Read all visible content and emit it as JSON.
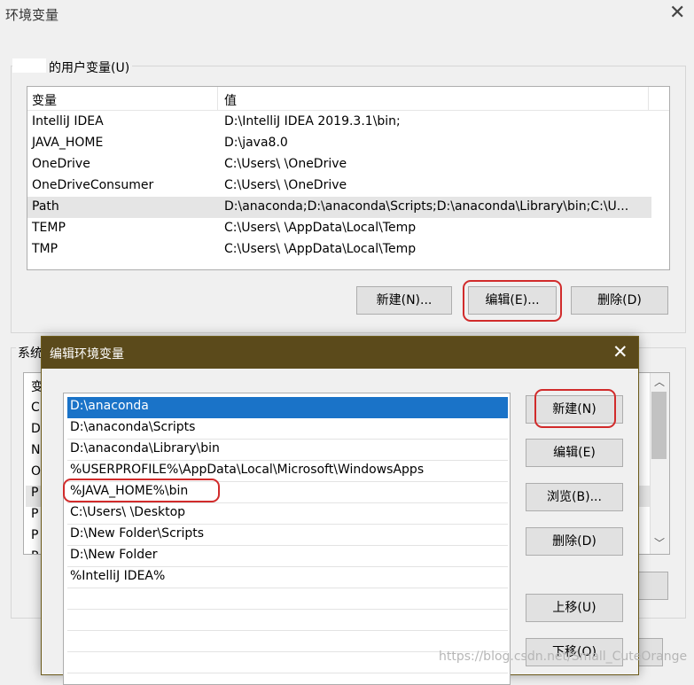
{
  "background_dialog": {
    "title": "环境变量",
    "close_glyph": "✕",
    "user_group_label": "的用户变量(U)",
    "table_headers": {
      "variable": "变量",
      "value": "值"
    },
    "user_variables": [
      {
        "name": "IntelliJ IDEA",
        "value": "D:\\IntelliJ IDEA 2019.3.1\\bin;"
      },
      {
        "name": "JAVA_HOME",
        "value": "D:\\java8.0"
      },
      {
        "name": "OneDrive",
        "value": "C:\\Users\\       \\OneDrive"
      },
      {
        "name": "OneDriveConsumer",
        "value": "C:\\Users\\       \\OneDrive"
      },
      {
        "name": "Path",
        "value": "D:\\anaconda;D:\\anaconda\\Scripts;D:\\anaconda\\Library\\bin;C:\\U..."
      },
      {
        "name": "TEMP",
        "value": "C:\\Users\\       \\AppData\\Local\\Temp"
      },
      {
        "name": "TMP",
        "value": "C:\\Users\\       \\AppData\\Local\\Temp"
      }
    ],
    "user_buttons": {
      "new": "新建(N)...",
      "edit": "编辑(E)...",
      "delete": "删除(D)"
    },
    "system_group_label": "系统",
    "system_visible_cells": [
      "变",
      "C",
      "D",
      "N",
      "O",
      "P",
      "P",
      "P",
      "P"
    ]
  },
  "edit_dialog": {
    "title": "编辑环境变量",
    "close_glyph": "✕",
    "entries": [
      "D:\\anaconda",
      "D:\\anaconda\\Scripts",
      "D:\\anaconda\\Library\\bin",
      "%USERPROFILE%\\AppData\\Local\\Microsoft\\WindowsApps",
      "%JAVA_HOME%\\bin",
      "C:\\Users\\       \\Desktop",
      "D:\\New Folder\\Scripts",
      "D:\\New Folder",
      "%IntelliJ IDEA%"
    ],
    "buttons": {
      "new": "新建(N)",
      "edit": "编辑(E)",
      "browse": "浏览(B)...",
      "delete": "删除(D)",
      "move_up": "上移(U)",
      "move_down": "下移(O)"
    }
  },
  "watermark": "https://blog.csdn.net/Small_CuteOrange",
  "colors": {
    "selection": "#1a73c8",
    "title_bar": "#5b4a1b",
    "highlight_ring": "#d12b2b"
  }
}
